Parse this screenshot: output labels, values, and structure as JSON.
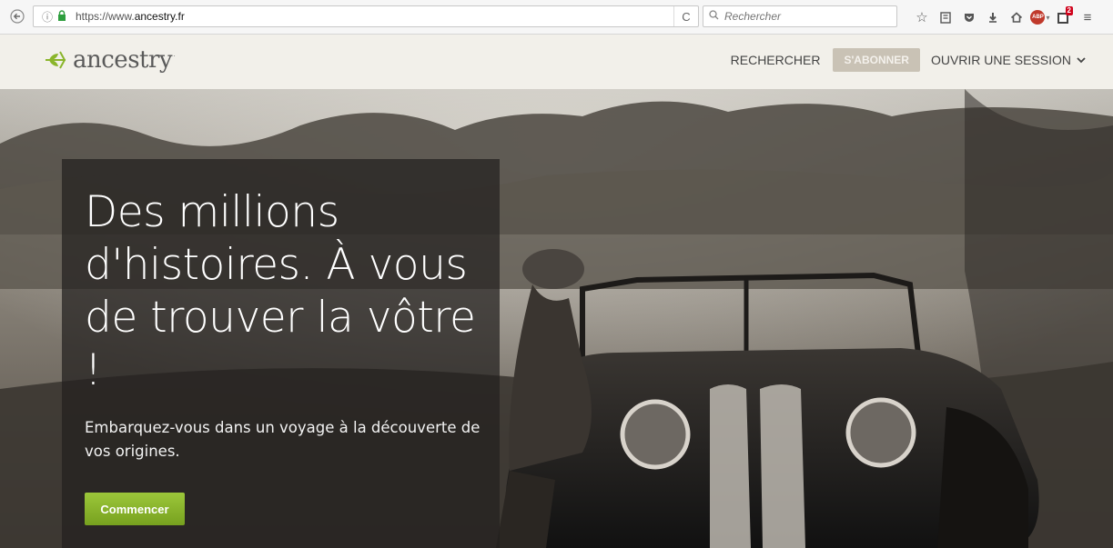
{
  "browser": {
    "url_prefix": "https://www.",
    "url_domain": "ancestry.fr",
    "search_placeholder": "Rechercher"
  },
  "site": {
    "logo_text": "ancestry",
    "nav": {
      "search": "RECHERCHER",
      "subscribe": "S'ABONNER",
      "signin": "OUVRIR UNE SESSION"
    }
  },
  "hero": {
    "headline": "Des millions d'histoires. À vous de trouver la vôtre !",
    "subtext": "Embarquez-vous dans un voyage à la découverte de vos origines.",
    "cta": "Commencer"
  },
  "colors": {
    "brand_green": "#8ab52b",
    "header_bg": "#f2f0ea",
    "subscribe_bg": "#c9c2b5"
  }
}
